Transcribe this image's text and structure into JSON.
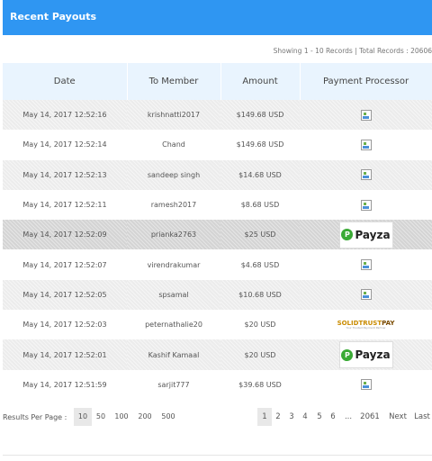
{
  "header": {
    "title": "Recent Payouts"
  },
  "summary": {
    "text": "Showing 1 - 10 Records | Total Records : 20606"
  },
  "table": {
    "columns": [
      "Date",
      "To Member",
      "Amount",
      "Payment Processor"
    ],
    "rows": [
      {
        "date": "May 14, 2017 12:52:16",
        "member": "krishnatti2017",
        "amount": "$149.68 USD",
        "processor": "broken-image-icon"
      },
      {
        "date": "May 14, 2017 12:52:14",
        "member": "Chand",
        "amount": "$149.68 USD",
        "processor": "broken-image-icon"
      },
      {
        "date": "May 14, 2017 12:52:13",
        "member": "sandeep singh",
        "amount": "$14.68 USD",
        "processor": "broken-image-icon"
      },
      {
        "date": "May 14, 2017 12:52:11",
        "member": "ramesh2017",
        "amount": "$8.68 USD",
        "processor": "broken-image-icon"
      },
      {
        "date": "May 14, 2017 12:52:09",
        "member": "prianka2763",
        "amount": "$25 USD",
        "processor": "payza"
      },
      {
        "date": "May 14, 2017 12:52:07",
        "member": "virendrakumar",
        "amount": "$4.68 USD",
        "processor": "broken-image-icon"
      },
      {
        "date": "May 14, 2017 12:52:05",
        "member": "spsamal",
        "amount": "$10.68 USD",
        "processor": "broken-image-icon"
      },
      {
        "date": "May 14, 2017 12:52:03",
        "member": "peternathalie20",
        "amount": "$20 USD",
        "processor": "solidtrustpay"
      },
      {
        "date": "May 14, 2017 12:52:01",
        "member": "Kashif Kamaal",
        "amount": "$20 USD",
        "processor": "payza"
      },
      {
        "date": "May 14, 2017 12:51:59",
        "member": "sarjit777",
        "amount": "$39.68 USD",
        "processor": "broken-image-icon"
      }
    ]
  },
  "logos": {
    "payza_mark": "P",
    "payza_text": "Payza",
    "stp_solid": "SOLID",
    "stp_trust": "TRUST",
    "stp_pay": "PAY",
    "stp_sub": "Your Trusted Payment Partner"
  },
  "pagination": {
    "per_page_label": "Results Per Page :",
    "per_page_options": [
      "10",
      "50",
      "100",
      "200",
      "500"
    ],
    "per_page_selected": "10",
    "pages": [
      "1",
      "2",
      "3",
      "4",
      "5",
      "6",
      "...",
      "2061",
      "Next",
      "Last"
    ],
    "current_page": "1"
  },
  "colors": {
    "header_bg": "#2f96f2",
    "table_header_bg": "#e9f4fe",
    "stripe": "#ececec"
  }
}
